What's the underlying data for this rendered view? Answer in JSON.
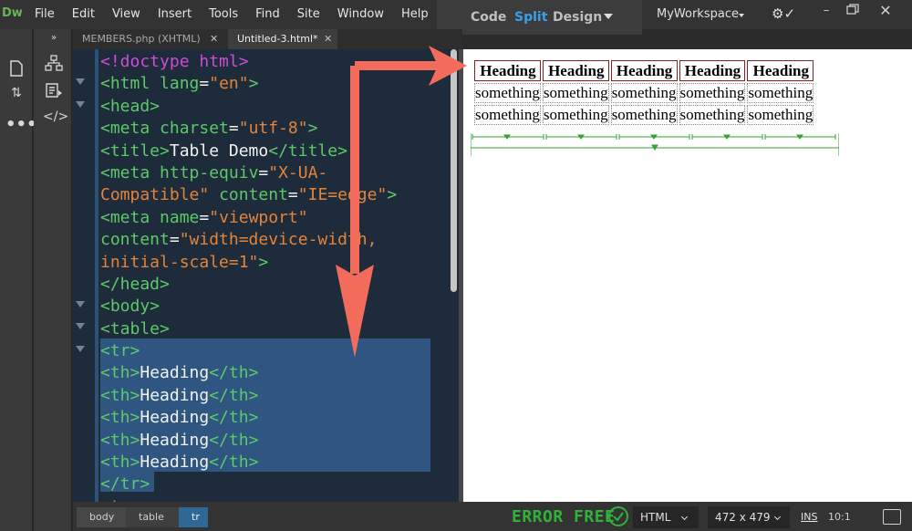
{
  "app": {
    "logo": "Dw"
  },
  "menubar": {
    "menus": [
      "File",
      "Edit",
      "View",
      "Insert",
      "Tools",
      "Find",
      "Site",
      "Window",
      "Help"
    ],
    "views": {
      "code": "Code",
      "split": "Split",
      "design": "Design",
      "active": "Split"
    },
    "workspace": "MyWorkspace"
  },
  "tabs": [
    {
      "label": "MEMBERS.php (XHTML)",
      "active": false
    },
    {
      "label": "Untitled-3.html*",
      "active": true
    }
  ],
  "code_lines": [
    [
      [
        "doctype",
        "<!doctype html>"
      ]
    ],
    [
      [
        "tag",
        "<html "
      ],
      [
        "attr",
        "lang"
      ],
      [
        "txt",
        "="
      ],
      [
        "str",
        "\"en\""
      ],
      [
        "tag",
        ">"
      ]
    ],
    [
      [
        "tag",
        "<head>"
      ]
    ],
    [
      [
        "tag",
        "<meta "
      ],
      [
        "attr",
        "charset"
      ],
      [
        "txt",
        "="
      ],
      [
        "str",
        "\"utf-8\""
      ],
      [
        "tag",
        ">"
      ]
    ],
    [
      [
        "tag",
        "<title>"
      ],
      [
        "txt",
        "Table Demo"
      ],
      [
        "tag",
        "</title>"
      ]
    ],
    [
      [
        "tag",
        "<meta "
      ],
      [
        "attr",
        "http-equiv"
      ],
      [
        "txt",
        "="
      ],
      [
        "str",
        "\"X-UA-"
      ]
    ],
    [
      [
        "str",
        "Compatible\""
      ],
      [
        "txt",
        " "
      ],
      [
        "attr",
        "content"
      ],
      [
        "txt",
        "="
      ],
      [
        "str",
        "\"IE=edge\""
      ],
      [
        "tag",
        ">"
      ]
    ],
    [
      [
        "tag",
        "<meta "
      ],
      [
        "attr",
        "name"
      ],
      [
        "txt",
        "="
      ],
      [
        "str",
        "\"viewport\""
      ]
    ],
    [
      [
        "attr",
        "content"
      ],
      [
        "txt",
        "="
      ],
      [
        "str",
        "\"width=device-width,"
      ]
    ],
    [
      [
        "str",
        "initial-scale=1\""
      ],
      [
        "tag",
        ">"
      ]
    ],
    [
      [
        "tag",
        "</head>"
      ]
    ],
    [
      [
        "tag",
        "<body>"
      ]
    ],
    [
      [
        "tag",
        "<table>"
      ]
    ],
    [
      [
        "tag",
        "<tr>"
      ]
    ],
    [
      [
        "tag",
        "<th>"
      ],
      [
        "txt",
        "Heading"
      ],
      [
        "tag",
        "</th>"
      ]
    ],
    [
      [
        "tag",
        "<th>"
      ],
      [
        "txt",
        "Heading"
      ],
      [
        "tag",
        "</th>"
      ]
    ],
    [
      [
        "tag",
        "<th>"
      ],
      [
        "txt",
        "Heading"
      ],
      [
        "tag",
        "</th>"
      ]
    ],
    [
      [
        "tag",
        "<th>"
      ],
      [
        "txt",
        "Heading"
      ],
      [
        "tag",
        "</th>"
      ]
    ],
    [
      [
        "tag",
        "<th>"
      ],
      [
        "txt",
        "Heading"
      ],
      [
        "tag",
        "</th>"
      ]
    ],
    [
      [
        "tag",
        "</tr>"
      ]
    ],
    [
      [
        "tag",
        "<tr>"
      ]
    ]
  ],
  "preview_table": {
    "headers": [
      "Heading",
      "Heading",
      "Heading",
      "Heading",
      "Heading"
    ],
    "rows": [
      [
        "something",
        "something",
        "something",
        "something",
        "something"
      ],
      [
        "something",
        "something",
        "something",
        "something",
        "something"
      ]
    ]
  },
  "statusbar": {
    "breadcrumbs": [
      "body",
      "table",
      "tr"
    ],
    "active_crumb": "tr",
    "lint_status": "ERROR FREE",
    "doc_type": "HTML",
    "window_size": "472 x 479",
    "insert_mode": "INS",
    "cursor_position": "10:1"
  },
  "colors": {
    "accent": "#3aa0e6",
    "tag": "#5ec96a",
    "doctype": "#d04bd6",
    "string": "#e4843c",
    "annotation_arrow": "#f26b5b",
    "error_free": "#2fb13a"
  }
}
